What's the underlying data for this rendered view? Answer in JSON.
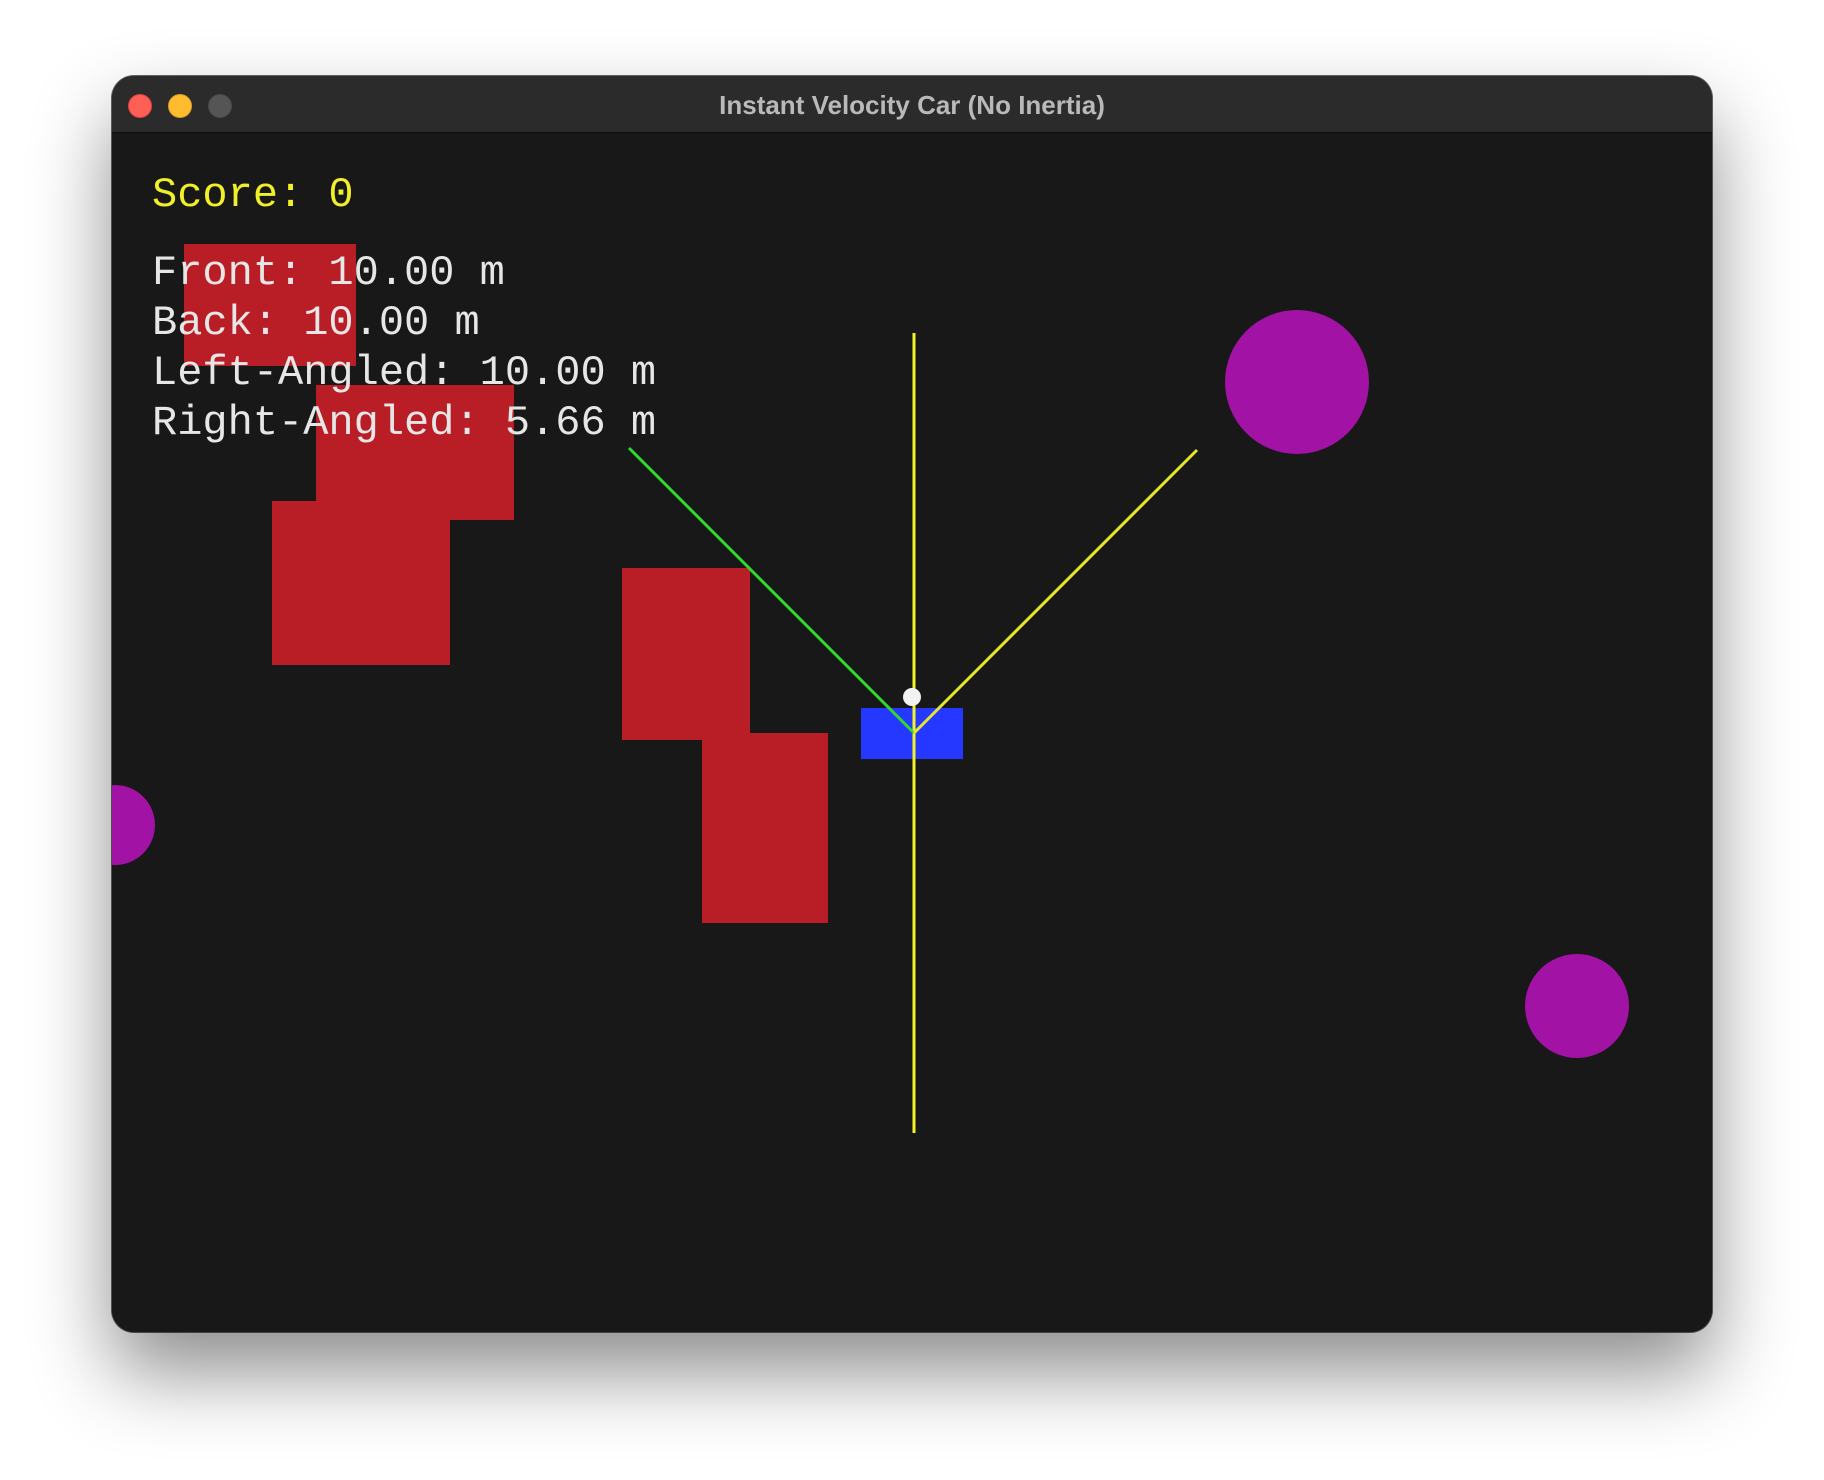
{
  "window": {
    "title": "Instant Velocity Car (No Inertia)"
  },
  "colors": {
    "background": "#181818",
    "obstacle_block": "#b91e26",
    "target_circle": "#a112a5",
    "car": "#2438ff",
    "sensor_front_back": "#f3f32a",
    "sensor_left": "#2ed82e",
    "sensor_right": "#e6e62a",
    "score_text": "#f0f02a",
    "readout_text": "#e6e6e6"
  },
  "hud": {
    "score_label": "Score: 0",
    "front_label": "Front: 10.00 m",
    "back_label": "Back: 10.00 m",
    "left_angled_label": "Left-Angled: 10.00 m",
    "right_angled_label": "Right-Angled: 5.66 m"
  },
  "game_state": {
    "score": 0,
    "sensors": {
      "front_m": 10.0,
      "back_m": 10.0,
      "left_angled_m": 10.0,
      "right_angled_m": 5.66
    }
  }
}
